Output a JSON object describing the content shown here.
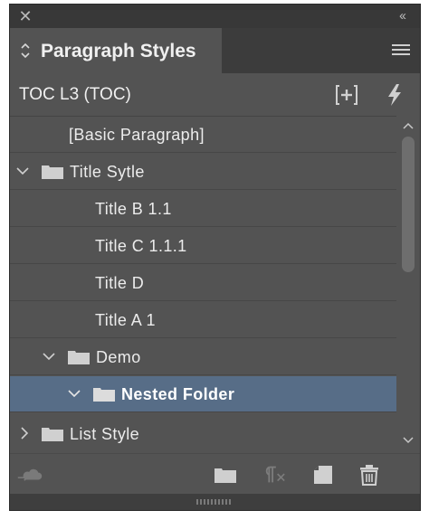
{
  "window": {
    "close_glyph": "✕",
    "collapse_glyph": "‹‹"
  },
  "tab": {
    "title": "Paragraph Styles",
    "icon": "sort-arrows-icon",
    "menu_icon": "panel-menu-icon"
  },
  "current_style": {
    "label": "TOC L3 (TOC)",
    "new_group_icon": "new-style-group-icon",
    "quick_apply_icon": "lightning-bolt-icon"
  },
  "styles": [
    {
      "label": "[Basic Paragraph]",
      "level": 0,
      "type": "style"
    },
    {
      "label": "Title Sytle",
      "level": 0,
      "type": "folder",
      "expanded": true
    },
    {
      "label": "Title B 1.1",
      "level": 1,
      "type": "style"
    },
    {
      "label": "Title C 1.1.1",
      "level": 1,
      "type": "style"
    },
    {
      "label": "Title D",
      "level": 1,
      "type": "style"
    },
    {
      "label": "Title A 1",
      "level": 1,
      "type": "style"
    },
    {
      "label": "Demo",
      "level": 1,
      "type": "folder",
      "expanded": true
    },
    {
      "label": "Nested Folder",
      "level": 2,
      "type": "folder",
      "expanded": true,
      "selected": true
    },
    {
      "label": "List Style",
      "level": 0,
      "type": "folder",
      "expanded": false
    }
  ],
  "bottom_icons": [
    "cloud-library-icon",
    "folder-icon",
    "clear-overrides-icon",
    "new-style-icon",
    "trash-icon"
  ],
  "colors": {
    "panel_bg": "#535353",
    "tab_strip": "#3c3c3c",
    "selection": "#576d87",
    "text": "#ececec"
  }
}
